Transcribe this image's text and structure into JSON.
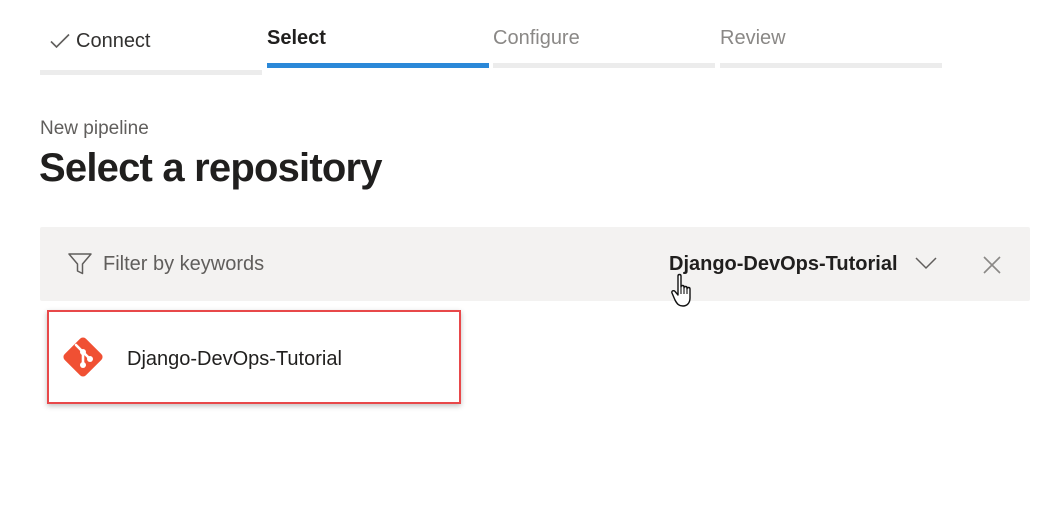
{
  "wizard": {
    "steps": [
      {
        "label": "Connect",
        "state": "completed"
      },
      {
        "label": "Select",
        "state": "active"
      },
      {
        "label": "Configure",
        "state": "upcoming"
      },
      {
        "label": "Review",
        "state": "upcoming"
      }
    ]
  },
  "page": {
    "subtitle": "New pipeline",
    "title": "Select a repository"
  },
  "filter": {
    "placeholder": "Filter by keywords",
    "value": "",
    "selected_repository": "Django-DevOps-Tutorial"
  },
  "repositories": [
    {
      "name": "Django-DevOps-Tutorial",
      "icon": "git-icon"
    }
  ],
  "colors": {
    "accent": "#2b88d8",
    "git_brand": "#f05033",
    "highlight_border": "#e8484a",
    "filter_background": "#f3f2f1"
  },
  "icons": {
    "completed_step": "check-icon",
    "filter": "filter-icon",
    "dropdown": "chevron-down-icon",
    "clear": "close-icon",
    "cursor": "hand-cursor-icon"
  }
}
